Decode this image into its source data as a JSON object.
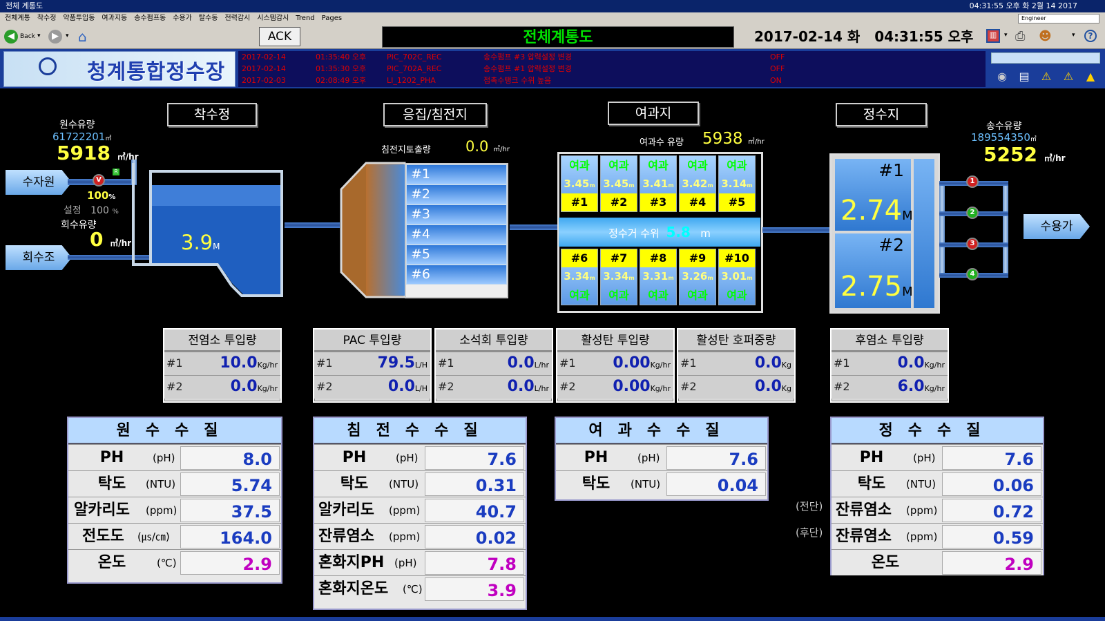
{
  "window": {
    "title": "전체 계통도",
    "clock": "04:31:55 오후  화 2월 14 2017"
  },
  "menu": [
    "전체계통",
    "착수정",
    "약품투입동",
    "여과지동",
    "송수펌프동",
    "수용가",
    "탈수동",
    "전력감시",
    "시스템감시",
    "Trend",
    "Pages"
  ],
  "user": "Engineer",
  "toolbar": {
    "back": "Back",
    "ack": "ACK",
    "page_title": "전체계통도",
    "date": "2017-02-14  화",
    "time": "04:31:55  오후"
  },
  "logo": {
    "name": "청계통합정수장"
  },
  "alarms": [
    {
      "date": "2017-02-14",
      "time": "01:35:40 오후",
      "tag": "PIC_702C_REC",
      "msg": "송수펌프 #3 압력설정 변경",
      "state": "OFF"
    },
    {
      "date": "2017-02-14",
      "time": "01:35:30 오후",
      "tag": "PIC_702A_REC",
      "msg": "송수펌프 #1 압력설정 변경",
      "state": "OFF"
    },
    {
      "date": "2017-02-03",
      "time": "02:08:49 오후",
      "tag": "LI_1202_PHA",
      "msg": "접촉수탱크 수위 높음",
      "state": "ON"
    }
  ],
  "process": {
    "intake": {
      "title": "착수정",
      "raw_flow_label": "원수유량",
      "raw_total": "61722201",
      "raw_total_unit": "㎥",
      "raw_flow": "5918",
      "flow_unit": "㎥/hr",
      "valve_pct": "100",
      "valve_pct_unit": "%",
      "setpoint_label": "설정",
      "setpoint": "100",
      "setpoint_unit": "%",
      "return_label": "회수유량",
      "return_flow": "0",
      "level": "3.9",
      "level_unit": "M",
      "source_label": "수자원",
      "return_tank_label": "회수조",
      "valve_tag": "V",
      "mode_tag": "R"
    },
    "sed": {
      "title": "응집/침전지",
      "discharge_label": "침전지토출량",
      "discharge": "0.0",
      "rows": [
        "#1",
        "#2",
        "#3",
        "#4",
        "#5",
        "#6"
      ]
    },
    "filter": {
      "title": "여과지",
      "flow_label": "여과수 유량",
      "flow": "5938",
      "collect_label": "정수거 수위",
      "collect_level": "5.8",
      "collect_unit": "m",
      "top": [
        {
          "status": "여과",
          "level": "3.45",
          "id": "#1"
        },
        {
          "status": "여과",
          "level": "3.45",
          "id": "#2"
        },
        {
          "status": "여과",
          "level": "3.41",
          "id": "#3"
        },
        {
          "status": "여과",
          "level": "3.42",
          "id": "#4"
        },
        {
          "status": "여과",
          "level": "3.14",
          "id": "#5"
        }
      ],
      "bottom": [
        {
          "status": "여과",
          "level": "3.34",
          "id": "#6"
        },
        {
          "status": "여과",
          "level": "3.34",
          "id": "#7"
        },
        {
          "status": "여과",
          "level": "3.31",
          "id": "#8"
        },
        {
          "status": "여과",
          "level": "3.26",
          "id": "#9"
        },
        {
          "status": "여과",
          "level": "3.01",
          "id": "#10"
        }
      ],
      "level_unit": "m"
    },
    "clearwell": {
      "title": "정수지",
      "tanks": [
        {
          "id": "#1",
          "level": "2.74",
          "unit": "M"
        },
        {
          "id": "#2",
          "level": "2.75",
          "unit": "M"
        }
      ]
    },
    "distribution": {
      "flow_label": "송수유량",
      "total": "189554350",
      "total_unit": "㎥",
      "flow": "5252",
      "consumer_label": "수용가",
      "pumps": [
        "1",
        "2",
        "3",
        "4"
      ]
    }
  },
  "dosing": [
    {
      "title": "전염소 투입량",
      "rows": [
        {
          "n": "#1",
          "v": "10.0",
          "u": "Kg/hr"
        },
        {
          "n": "#2",
          "v": "0.0",
          "u": "Kg/hr"
        }
      ]
    },
    {
      "title": "PAC 투입량",
      "rows": [
        {
          "n": "#1",
          "v": "79.5",
          "u": "L/H"
        },
        {
          "n": "#2",
          "v": "0.0",
          "u": "L/H"
        }
      ]
    },
    {
      "title": "소석회 투입량",
      "rows": [
        {
          "n": "#1",
          "v": "0.0",
          "u": "L/hr"
        },
        {
          "n": "#2",
          "v": "0.0",
          "u": "L/hr"
        }
      ]
    },
    {
      "title": "활성탄 투입량",
      "rows": [
        {
          "n": "#1",
          "v": "0.00",
          "u": "Kg/hr"
        },
        {
          "n": "#2",
          "v": "0.00",
          "u": "Kg/hr"
        }
      ]
    },
    {
      "title": "활성탄 호퍼중량",
      "rows": [
        {
          "n": "#1",
          "v": "0.0",
          "u": "Kg"
        },
        {
          "n": "#2",
          "v": "0.0",
          "u": "Kg"
        }
      ]
    },
    {
      "title": "후염소 투입량",
      "rows": [
        {
          "n": "#1",
          "v": "0.0",
          "u": "Kg/hr"
        },
        {
          "n": "#2",
          "v": "6.0",
          "u": "Kg/hr"
        }
      ]
    }
  ],
  "quality": [
    {
      "title": "원수수질",
      "rows": [
        {
          "n": "PH",
          "u": "(pH)",
          "v": "8.0"
        },
        {
          "n": "탁도",
          "u": "(NTU)",
          "v": "5.74"
        },
        {
          "n": "알카리도",
          "u": "(ppm)",
          "v": "37.5"
        },
        {
          "n": "전도도",
          "u": "(㎲/㎝)",
          "v": "164.0"
        },
        {
          "n": "온도",
          "u": "(℃)",
          "v": "2.9",
          "mag": true
        }
      ]
    },
    {
      "title": "침전수수질",
      "rows": [
        {
          "n": "PH",
          "u": "(pH)",
          "v": "7.6"
        },
        {
          "n": "탁도",
          "u": "(NTU)",
          "v": "0.31"
        },
        {
          "n": "알카리도",
          "u": "(ppm)",
          "v": "40.7"
        },
        {
          "n": "잔류염소",
          "u": "(ppm)",
          "v": "0.02"
        },
        {
          "n": "혼화지PH",
          "u": "(pH)",
          "v": "7.8",
          "mag": true
        },
        {
          "n": "혼화지온도",
          "u": "(℃)",
          "v": "3.9",
          "mag": true
        }
      ]
    },
    {
      "title": "여과수수질",
      "rows": [
        {
          "n": "PH",
          "u": "(pH)",
          "v": "7.6"
        },
        {
          "n": "탁도",
          "u": "(NTU)",
          "v": "0.04"
        }
      ]
    },
    {
      "title": "정수수질",
      "rows": [
        {
          "n": "PH",
          "u": "(pH)",
          "v": "7.6"
        },
        {
          "n": "탁도",
          "u": "(NTU)",
          "v": "0.06"
        },
        {
          "n": "잔류염소",
          "u": "(ppm)",
          "v": "0.72",
          "pre": "(전단)"
        },
        {
          "n": "잔류염소",
          "u": "(ppm)",
          "v": "0.59",
          "pre": "(후단)"
        },
        {
          "n": "온도",
          "u": "",
          "v": "2.9",
          "mag": true
        }
      ]
    }
  ],
  "colors": {
    "value_blue": "#1a3cc0",
    "magenta": "#c000c0",
    "yellow": "#ffff40",
    "green": "#00e000"
  }
}
